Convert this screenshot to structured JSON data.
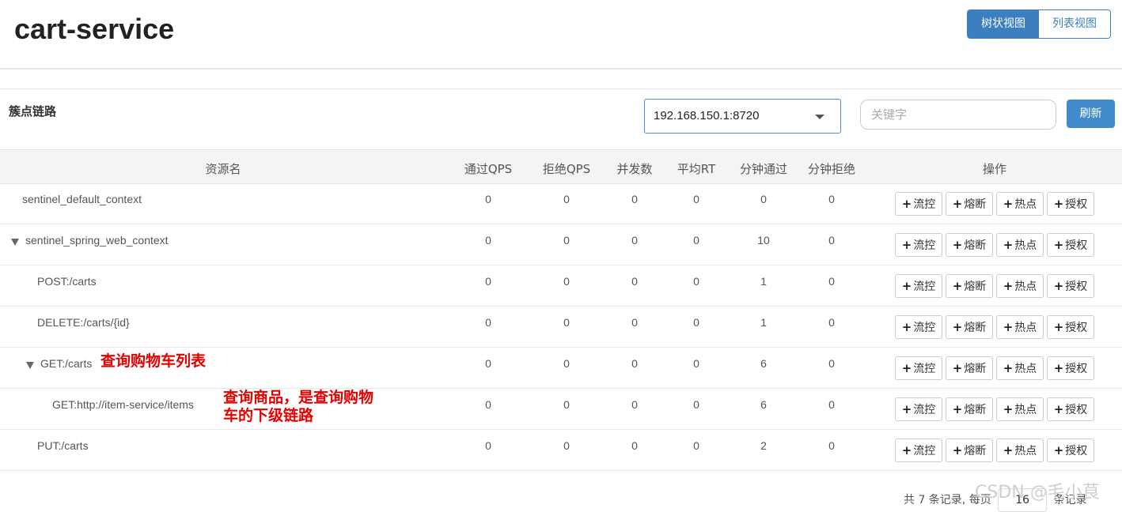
{
  "header": {
    "title": "cart-service",
    "views": [
      "树状视图",
      "列表视图"
    ]
  },
  "panel": {
    "title": "簇点链路",
    "machine_value": "192.168.150.1:8720",
    "search_placeholder": "关键字",
    "refresh_label": "刷新"
  },
  "table": {
    "columns": [
      "资源名",
      "通过QPS",
      "拒绝QPS",
      "并发数",
      "平均RT",
      "分钟通过",
      "分钟拒绝",
      "操作"
    ],
    "action_labels": [
      "流控",
      "熔断",
      "热点",
      "授权"
    ],
    "rows": [
      {
        "name": "sentinel_default_context",
        "pass_qps": "0",
        "block_qps": "0",
        "threads": "0",
        "avg_rt": "0",
        "min_pass": "0",
        "min_block": "0"
      },
      {
        "name": "sentinel_spring_web_context",
        "pass_qps": "0",
        "block_qps": "0",
        "threads": "0",
        "avg_rt": "0",
        "min_pass": "10",
        "min_block": "0"
      },
      {
        "name": "POST:/carts",
        "pass_qps": "0",
        "block_qps": "0",
        "threads": "0",
        "avg_rt": "0",
        "min_pass": "1",
        "min_block": "0"
      },
      {
        "name": "DELETE:/carts/{id}",
        "pass_qps": "0",
        "block_qps": "0",
        "threads": "0",
        "avg_rt": "0",
        "min_pass": "1",
        "min_block": "0"
      },
      {
        "name": "GET:/carts",
        "pass_qps": "0",
        "block_qps": "0",
        "threads": "0",
        "avg_rt": "0",
        "min_pass": "6",
        "min_block": "0"
      },
      {
        "name": "GET:http://item-service/items",
        "pass_qps": "0",
        "block_qps": "0",
        "threads": "0",
        "avg_rt": "0",
        "min_pass": "6",
        "min_block": "0"
      },
      {
        "name": "PUT:/carts",
        "pass_qps": "0",
        "block_qps": "0",
        "threads": "0",
        "avg_rt": "0",
        "min_pass": "2",
        "min_block": "0"
      }
    ]
  },
  "annotations": {
    "carts_note": "查询购物车列表",
    "items_note_line1": "查询商品，是查询购物",
    "items_note_line2": "车的下级链路"
  },
  "pagination": {
    "prefix": "共 7 条记录, 每页",
    "page_size": "16",
    "suffix": "条记录"
  },
  "watermark": "CSDN @毛小茛",
  "colors": {
    "primary": "#428bca",
    "annotation": "#e60000"
  }
}
